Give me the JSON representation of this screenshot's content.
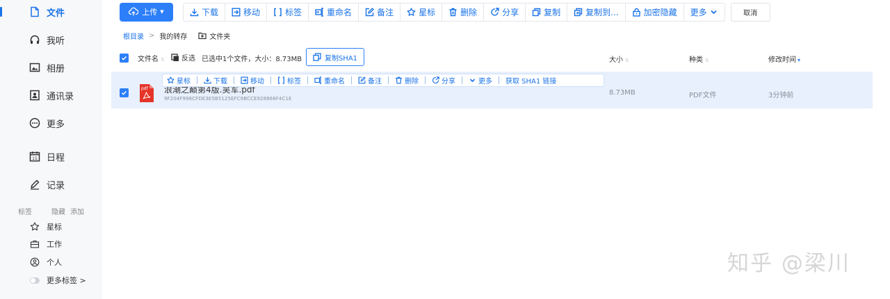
{
  "sidebar": {
    "items": [
      {
        "label": "文件",
        "icon": "file-icon"
      },
      {
        "label": "我听",
        "icon": "headphones-icon"
      },
      {
        "label": "相册",
        "icon": "image-icon"
      },
      {
        "label": "通讯录",
        "icon": "contact-icon"
      },
      {
        "label": "更多",
        "icon": "more-circle-icon"
      },
      {
        "label": "日程",
        "icon": "calendar-icon",
        "calendar_day": "15"
      },
      {
        "label": "记录",
        "icon": "pen-icon"
      }
    ],
    "tags_header": {
      "title": "标签",
      "hide": "隐藏",
      "add": "添加"
    },
    "tags": [
      {
        "label": "星标",
        "icon": "star-icon"
      },
      {
        "label": "工作",
        "icon": "briefcase-icon"
      },
      {
        "label": "个人",
        "icon": "person-icon"
      },
      {
        "label": "更多标签 >",
        "icon": "toggle-icon"
      }
    ]
  },
  "toolbar": {
    "upload": "上传",
    "buttons": [
      {
        "label": "下载",
        "icon": "download-icon"
      },
      {
        "label": "移动",
        "icon": "move-icon"
      },
      {
        "label": "标签",
        "icon": "tag-bracket-icon"
      },
      {
        "label": "重命名",
        "icon": "rename-icon"
      },
      {
        "label": "备注",
        "icon": "note-icon"
      },
      {
        "label": "星标",
        "icon": "star-icon"
      },
      {
        "label": "删除",
        "icon": "trash-icon"
      },
      {
        "label": "分享",
        "icon": "share-icon"
      },
      {
        "label": "复制",
        "icon": "copy-icon"
      },
      {
        "label": "复制到...",
        "icon": "copy-to-icon"
      },
      {
        "label": "加密隐藏",
        "icon": "lock-icon"
      },
      {
        "label": "更多",
        "icon": "chevron-down-icon"
      }
    ],
    "cancel": "取消"
  },
  "breadcrumb": {
    "root": "根目录",
    "separator": ">",
    "current": "我的转存",
    "new_folder": "文件夹"
  },
  "list_header": {
    "name": "文件名",
    "invert": "反选",
    "selection_info": "已选中1个文件，大小：8.73MB",
    "copy_sha1": "复制SHA1",
    "size": "大小",
    "type": "种类",
    "modified": "修改时间"
  },
  "files": [
    {
      "name": "浪潮之巅第4版.吴军.pdf",
      "hash": "9F204F996CFDE3E5B5125EFC9BCCE928866F4C1E",
      "size": "8.73MB",
      "type": "PDF文件",
      "modified": "3分钟前",
      "file_icon_label": "pdf"
    }
  ],
  "row_actions": [
    {
      "label": "星标",
      "icon": "star-icon"
    },
    {
      "label": "下载",
      "icon": "download-icon"
    },
    {
      "label": "移动",
      "icon": "move-icon"
    },
    {
      "label": "标签",
      "icon": "tag-bracket-icon"
    },
    {
      "label": "重命名",
      "icon": "rename-icon"
    },
    {
      "label": "备注",
      "icon": "note-icon"
    },
    {
      "label": "删除",
      "icon": "trash-icon"
    },
    {
      "label": "分享",
      "icon": "share-icon"
    },
    {
      "label": "更多",
      "icon": "chevron-down-icon"
    },
    {
      "label": "获取 SHA1 链接",
      "icon": ""
    }
  ],
  "watermark": "知乎 @梁川",
  "colors": {
    "accent": "#2d7ff9",
    "link": "#1a73e8",
    "row_selected": "#e8f0fd",
    "sidebar_bg": "#f7f8fa",
    "pdf_red": "#e5352a"
  }
}
